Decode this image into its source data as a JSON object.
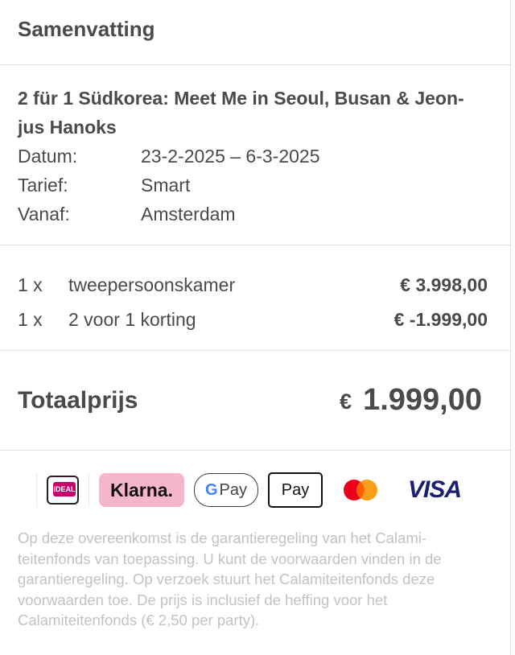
{
  "summary": {
    "title": "Samenvatting"
  },
  "trip": {
    "name": "2 für 1 Südkorea: Meet Me in Seoul, Busan & Jeon-jus Hanoks",
    "details": [
      {
        "label": "Datum:",
        "value": "23-2-2025 – 6-3-2025"
      },
      {
        "label": "Tarief:",
        "value": "Smart"
      },
      {
        "label": "Vanaf:",
        "value": "Amsterdam"
      }
    ]
  },
  "lines": [
    {
      "qty": "1 x",
      "desc": "tweepersoonskamer",
      "amount": "€ 3.998,00"
    },
    {
      "qty": "1 x",
      "desc": "2 voor 1 korting",
      "amount": "€ -1.999,00"
    }
  ],
  "total": {
    "label": "Totaalprijs",
    "currency": "€",
    "value": "1.999,00"
  },
  "payments": {
    "ideal": "iDEAL",
    "klarna": "Klarna.",
    "gpay_g": "G",
    "gpay": "Pay",
    "apple_logo": "",
    "apay": "Pay",
    "visa": "VISA",
    "icons": [
      "ideal-logo",
      "klarna-logo",
      "google-pay-logo",
      "apple-pay-logo",
      "mastercard-logo",
      "visa-logo"
    ]
  },
  "legal": "Op deze overeenkomst is de garantieregeling van het Calami-teitenfonds van toepassing. U kunt de voorwaarden vinden in de garantieregeling. Op verzoek stuurt het Calamiteitenfonds deze voorwaarden toe. De prijs is inclusief de heffing voor het Calamiteitenfonds (€ 2,50 per party).",
  "colors": {
    "text": "#4a4a4a",
    "muted": "#c2c2c2",
    "divider": "#e0e0e0",
    "klarna": "#f5b6c9",
    "visa": "#1a1f71"
  }
}
